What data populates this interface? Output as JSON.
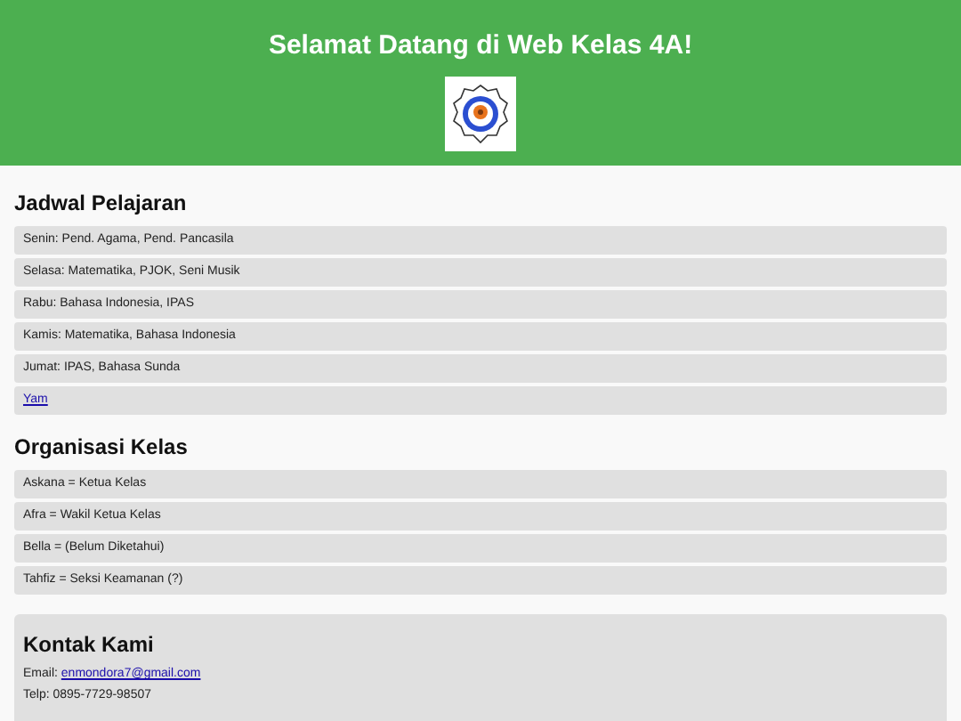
{
  "header": {
    "title": "Selamat Datang di Web Kelas 4A!"
  },
  "schedule": {
    "heading": "Jadwal Pelajaran",
    "items": [
      {
        "kind": "text",
        "text": "Senin: Pend. Agama, Pend. Pancasila"
      },
      {
        "kind": "text",
        "text": "Selasa: Matematika, PJOK, Seni Musik"
      },
      {
        "kind": "text",
        "text": "Rabu: Bahasa Indonesia, IPAS"
      },
      {
        "kind": "text",
        "text": "Kamis: Matematika, Bahasa Indonesia"
      },
      {
        "kind": "text",
        "text": "Jumat: IPAS, Bahasa Sunda"
      },
      {
        "kind": "link",
        "text": "Yam"
      }
    ]
  },
  "organization": {
    "heading": "Organisasi Kelas",
    "items": [
      {
        "kind": "text",
        "text": "Askana = Ketua Kelas"
      },
      {
        "kind": "text",
        "text": "Afra = Wakil Ketua Kelas"
      },
      {
        "kind": "text",
        "text": "Bella = (Belum Diketahui)"
      },
      {
        "kind": "text",
        "text": "Tahfiz = Seksi Keamanan (?)"
      }
    ]
  },
  "contact": {
    "heading": "Kontak Kami",
    "email_label": "Email:",
    "email": "enmondora7@gmail.com",
    "phone": "Telp: 0895-7729-98507"
  }
}
